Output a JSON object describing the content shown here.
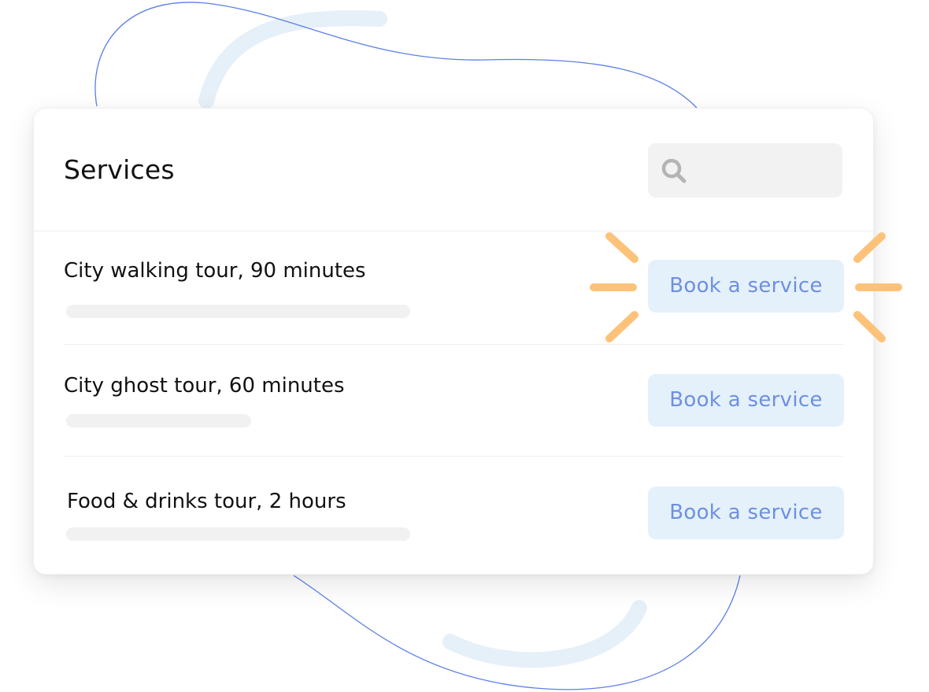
{
  "header": {
    "title": "Services",
    "search_icon": "search-icon"
  },
  "services": [
    {
      "name": "City walking tour, 90 minutes",
      "button_label": "Book a service",
      "highlighted": true
    },
    {
      "name": "City ghost tour, 60 minutes",
      "button_label": "Book a service",
      "highlighted": false
    },
    {
      "name": "Food & drinks tour, 2 hours",
      "button_label": "Book a service",
      "highlighted": false
    }
  ],
  "colors": {
    "accent_text": "#6f8fe0",
    "button_bg": "#e4f1fb",
    "spark": "#fdc27a",
    "line": "#5b7fe6",
    "deco_arc": "#e6f0f8"
  }
}
